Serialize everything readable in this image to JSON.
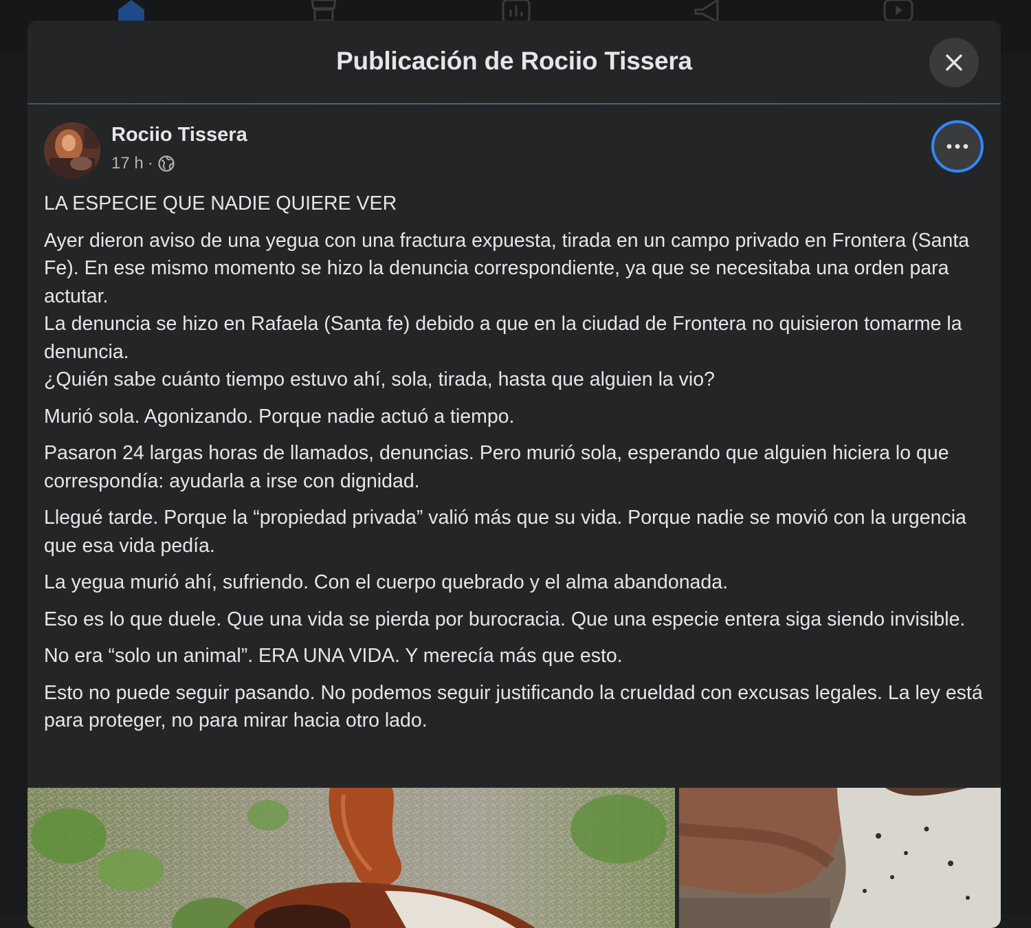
{
  "modal": {
    "title": "Publicación de Rociio Tissera"
  },
  "post": {
    "author": "Rociio Tissera",
    "time": "17 h",
    "separator": "·",
    "audience_icon": "globe-icon",
    "paragraphs": [
      "LA ESPECIE QUE NADIE QUIERE VER",
      "Ayer dieron aviso de una yegua con una fractura expuesta, tirada en un campo privado en Frontera (Santa Fe). En ese mismo momento se hizo la denuncia correspondiente, ya que se necesitaba una orden para actutar.\nLa denuncia se hizo en Rafaela (Santa fe) debido a que en la ciudad de Frontera no quisieron tomarme la denuncia.\n¿Quién sabe cuánto tiempo estuvo ahí, sola, tirada, hasta que alguien la vio?",
      "Murió sola. Agonizando. Porque nadie actuó a tiempo.",
      "Pasaron 24 largas horas de llamados, denuncias. Pero murió sola, esperando que alguien hiciera lo que correspondía: ayudarla a irse con dignidad.",
      "Llegué tarde. Porque la “propiedad privada” valió más que su vida. Porque nadie se movió con la urgencia que esa vida pedía.",
      "La yegua murió ahí, sufriendo. Con el cuerpo quebrado y el alma abandonada.",
      "Eso es lo que duele. Que una vida se pierda por burocracia. Que una especie entera siga siendo invisible.",
      "No era “solo un animal”. ERA UNA VIDA. Y merecía más que esto.",
      "Esto no puede seguir pasando. No podemos seguir justificando la crueldad con excusas legales. La ley está para proteger, no para mirar hacia otro lado."
    ]
  },
  "colors": {
    "modal_bg": "#242526",
    "button_bg": "#3a3b3c",
    "focus_ring": "#2d88ff",
    "text_primary": "#e4e6eb",
    "text_secondary": "#b0b3b8"
  },
  "icons": {
    "close": "close-icon",
    "more": "more-options-icon",
    "nav": [
      "home-icon",
      "marketplace-icon",
      "reports-icon",
      "announcements-icon",
      "video-icon"
    ]
  }
}
